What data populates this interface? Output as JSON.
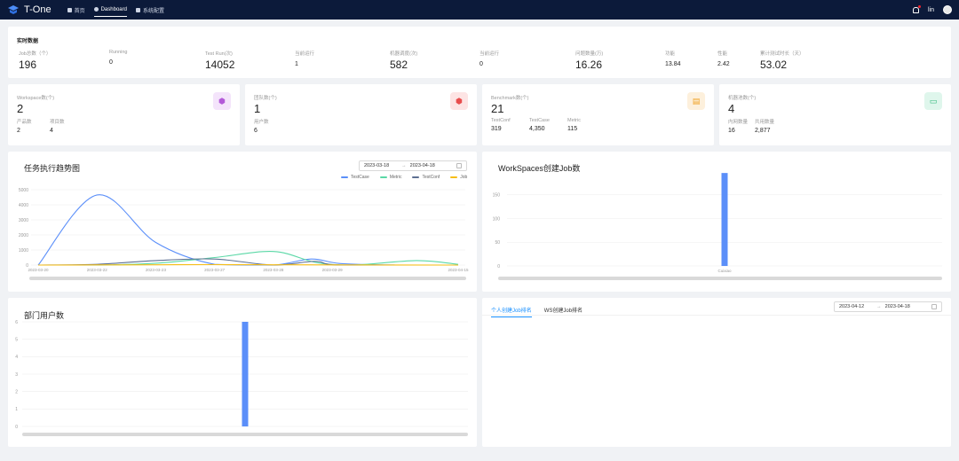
{
  "header": {
    "title": "T-One",
    "nav": [
      {
        "label": "首页",
        "icon": "home-icon"
      },
      {
        "label": "Dashboard",
        "icon": "dashboard-icon"
      },
      {
        "label": "系统配置",
        "icon": "settings-icon"
      }
    ],
    "user": "lin"
  },
  "realtime": {
    "title": "实时数据",
    "items": [
      {
        "label": "Job总数（个）",
        "value": "196"
      },
      {
        "label": "Running",
        "value": "0"
      },
      {
        "label": "Test Run(次)",
        "value": "14052"
      },
      {
        "label": "当前运行",
        "value": "1"
      },
      {
        "label": "机器调度(次)",
        "value": "582"
      },
      {
        "label": "当前运行",
        "value": "0"
      },
      {
        "label": "问题数量(万)",
        "value": "16.26"
      },
      {
        "label": "功能",
        "value": "13.84"
      },
      {
        "label": "性能",
        "value": "2.42"
      },
      {
        "label": "累计测试时长（天）",
        "value": "53.02"
      }
    ]
  },
  "stats": [
    {
      "label": "Workspace数(个)",
      "value": "2",
      "icon": "cube-icon",
      "subs": [
        {
          "label": "产品数",
          "value": "2"
        },
        {
          "label": "项目数",
          "value": "4"
        }
      ]
    },
    {
      "label": "团队数(个)",
      "value": "1",
      "icon": "team-icon",
      "subs": [
        {
          "label": "用户数",
          "value": "6"
        }
      ]
    },
    {
      "label": "Benchmark数(个)",
      "value": "21",
      "icon": "document-icon",
      "subs": [
        {
          "label": "TestConf",
          "value": "319"
        },
        {
          "label": "TestCase",
          "value": "4,350"
        },
        {
          "label": "Metric",
          "value": "115"
        }
      ]
    },
    {
      "label": "机器池数(个)",
      "value": "4",
      "icon": "server-icon",
      "subs": [
        {
          "label": "内网数量",
          "value": "16"
        },
        {
          "label": "共用数量",
          "value": "2,877"
        }
      ]
    }
  ],
  "trend": {
    "title": "任务执行趋势图",
    "date_start": "2023-03-18",
    "date_end": "2023-04-18",
    "separator": "→",
    "legend": [
      {
        "name": "TestCase",
        "color": "#5b8ff9"
      },
      {
        "name": "Metric",
        "color": "#5ad8a6"
      },
      {
        "name": "TestConf",
        "color": "#5d7092"
      },
      {
        "name": "Job",
        "color": "#f6bd16"
      }
    ]
  },
  "ws_chart_title": "WorkSpaces创建Job数",
  "dept_chart_title": "部门用户数",
  "ranking": {
    "tabs": [
      "个人创建Job排名",
      "WS创建Job排名"
    ],
    "date_start": "2023-04-12",
    "date_end": "2023-04-18",
    "separator": "→"
  },
  "chart_data": [
    {
      "type": "line",
      "title": "任务执行趋势图",
      "x": [
        "2023-03-20",
        "2023-03-22",
        "2023-03-23",
        "2023-03-27",
        "2023-03-28",
        "2023-03-29",
        "2023-04-15"
      ],
      "ylim": [
        0,
        5000
      ],
      "yticks": [
        0,
        1000,
        2000,
        3000,
        4000,
        5000
      ],
      "x_positions": [
        0,
        0.14,
        0.28,
        0.42,
        0.56,
        0.7,
        1.0
      ],
      "series": [
        {
          "name": "TestCase",
          "color": "#5b8ff9",
          "points": [
            [
              0,
              0
            ],
            [
              0.14,
              4650
            ],
            [
              0.28,
              1500
            ],
            [
              0.42,
              50
            ],
            [
              0.56,
              0
            ],
            [
              0.65,
              400
            ],
            [
              0.72,
              100
            ],
            [
              0.85,
              0
            ],
            [
              1.0,
              0
            ]
          ]
        },
        {
          "name": "Metric",
          "color": "#5ad8a6",
          "points": [
            [
              0,
              0
            ],
            [
              0.14,
              0
            ],
            [
              0.28,
              120
            ],
            [
              0.42,
              500
            ],
            [
              0.56,
              900
            ],
            [
              0.66,
              180
            ],
            [
              0.75,
              0
            ],
            [
              0.9,
              300
            ],
            [
              1.0,
              50
            ]
          ]
        },
        {
          "name": "TestConf",
          "color": "#5d7092",
          "points": [
            [
              0,
              0
            ],
            [
              0.14,
              50
            ],
            [
              0.28,
              300
            ],
            [
              0.42,
              400
            ],
            [
              0.56,
              0
            ],
            [
              0.66,
              250
            ],
            [
              0.72,
              0
            ],
            [
              1.0,
              0
            ]
          ]
        },
        {
          "name": "Job",
          "color": "#f6bd16",
          "points": [
            [
              0,
              0
            ],
            [
              0.14,
              10
            ],
            [
              0.28,
              20
            ],
            [
              0.42,
              30
            ],
            [
              0.56,
              20
            ],
            [
              0.7,
              10
            ],
            [
              1.0,
              0
            ]
          ]
        }
      ]
    },
    {
      "type": "bar",
      "title": "WorkSpaces创建Job数",
      "categories": [
        "Cuixiao"
      ],
      "values": [
        196
      ],
      "ylim": [
        0,
        200
      ],
      "yticks": [
        0,
        50,
        100,
        150
      ]
    },
    {
      "type": "bar",
      "title": "部门用户数",
      "categories": [
        ""
      ],
      "values": [
        6
      ],
      "ylim": [
        0,
        6
      ],
      "yticks": [
        0,
        1,
        2,
        3,
        4,
        5,
        6
      ]
    }
  ]
}
